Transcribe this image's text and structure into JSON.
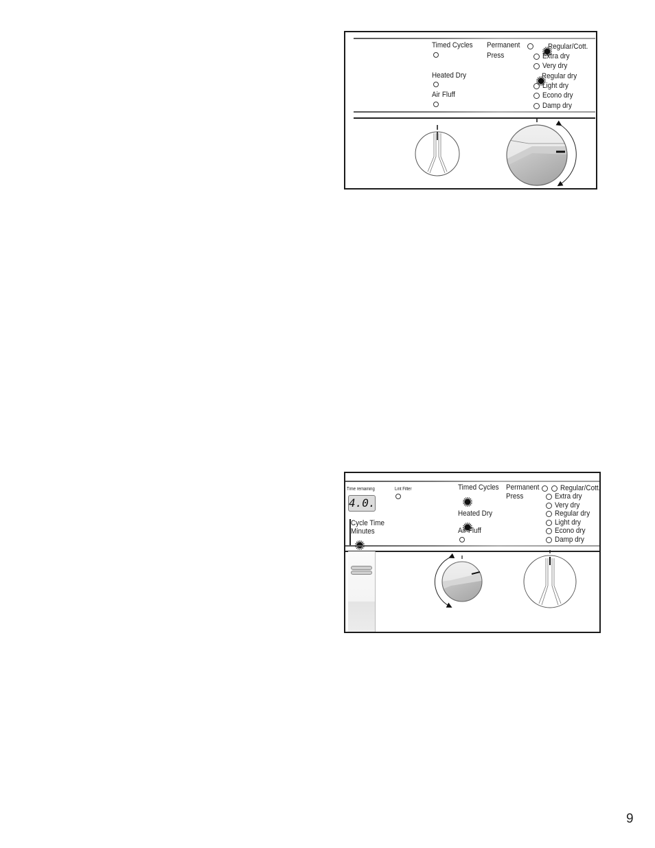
{
  "page_number": "9",
  "panel_top": {
    "cycle_selectors": [
      {
        "label": "Timed Cycles",
        "state": "off"
      },
      {
        "label": "Heated Dry",
        "state": "off"
      },
      {
        "label": "Air Fluff",
        "state": "off"
      }
    ],
    "permanent_press": {
      "label_line1": "Permanent",
      "label_line2": "Press",
      "state": "off"
    },
    "dryness_options": [
      {
        "label": "Regular/Cott.",
        "state": "on"
      },
      {
        "label": "Extra dry",
        "state": "off"
      },
      {
        "label": "Very dry",
        "state": "off"
      },
      {
        "label": "Regular dry",
        "state": "on"
      },
      {
        "label": "Light dry",
        "state": "off"
      },
      {
        "label": "Econo dry",
        "state": "off"
      },
      {
        "label": "Damp dry",
        "state": "off"
      }
    ],
    "knobs": [
      {
        "name": "start-knob",
        "style": "plain"
      },
      {
        "name": "program-knob",
        "style": "shaded",
        "rotation_arrows": true
      }
    ]
  },
  "panel_bottom": {
    "time_remaining_label": "Time remaining",
    "time_remaining_value": "4.0.",
    "lint_filter": {
      "label": "Lint Filter",
      "state": "off"
    },
    "cycle_time": {
      "label_line1": "Cycle Time",
      "label_line2": "Minutes",
      "state": "on"
    },
    "cycle_selectors": [
      {
        "label": "Timed Cycles",
        "state": "on"
      },
      {
        "label": "Heated Dry",
        "state": "on"
      },
      {
        "label": "Air Fluff",
        "state": "off"
      }
    ],
    "permanent_press": {
      "label_line1": "Permanent",
      "label_line2": "Press",
      "state": "off"
    },
    "dryness_options": [
      {
        "label": "Regular/Cott.",
        "state": "off"
      },
      {
        "label": "Extra dry",
        "state": "off"
      },
      {
        "label": "Very dry",
        "state": "off"
      },
      {
        "label": "Regular dry",
        "state": "off"
      },
      {
        "label": "Light dry",
        "state": "off"
      },
      {
        "label": "Econo dry",
        "state": "off"
      },
      {
        "label": "Damp dry",
        "state": "off"
      }
    ],
    "knobs": [
      {
        "name": "program-knob",
        "style": "shaded",
        "rotation_arrows": true
      },
      {
        "name": "start-knob",
        "style": "plain"
      }
    ]
  }
}
